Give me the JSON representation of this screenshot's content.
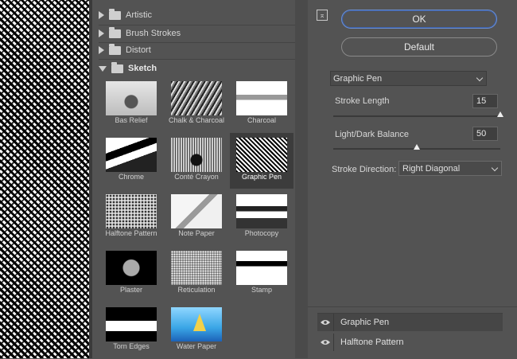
{
  "gallery": {
    "folders": [
      {
        "label": "Artistic",
        "open": false
      },
      {
        "label": "Brush Strokes",
        "open": false
      },
      {
        "label": "Distort",
        "open": false
      },
      {
        "label": "Sketch",
        "open": true
      }
    ],
    "thumbnails": [
      {
        "label": "Bas Relief",
        "selected": false
      },
      {
        "label": "Chalk & Charcoal",
        "selected": false
      },
      {
        "label": "Charcoal",
        "selected": false
      },
      {
        "label": "Chrome",
        "selected": false
      },
      {
        "label": "Conté Crayon",
        "selected": false
      },
      {
        "label": "Graphic Pen",
        "selected": true
      },
      {
        "label": "Halftone Pattern",
        "selected": false
      },
      {
        "label": "Note Paper",
        "selected": false
      },
      {
        "label": "Photocopy",
        "selected": false
      },
      {
        "label": "Plaster",
        "selected": false
      },
      {
        "label": "Reticulation",
        "selected": false
      },
      {
        "label": "Stamp",
        "selected": false
      },
      {
        "label": "Torn Edges",
        "selected": false
      },
      {
        "label": "Water Paper",
        "selected": false
      }
    ]
  },
  "buttons": {
    "collapse_glyph": "⌅",
    "ok_label": "OK",
    "default_label": "Default"
  },
  "filter_select": {
    "value": "Graphic Pen"
  },
  "settings": {
    "stroke_length": {
      "label": "Stroke Length",
      "value": "15"
    },
    "light_dark_balance": {
      "label": "Light/Dark Balance",
      "value": "50"
    },
    "stroke_direction": {
      "label": "Stroke Direction:",
      "value": "Right Diagonal"
    }
  },
  "layers": [
    {
      "label": "Graphic Pen",
      "active": true
    },
    {
      "label": "Halftone Pattern",
      "active": false
    }
  ],
  "colors": {
    "panel_bg": "#535353",
    "accent": "#6b8fd2"
  }
}
